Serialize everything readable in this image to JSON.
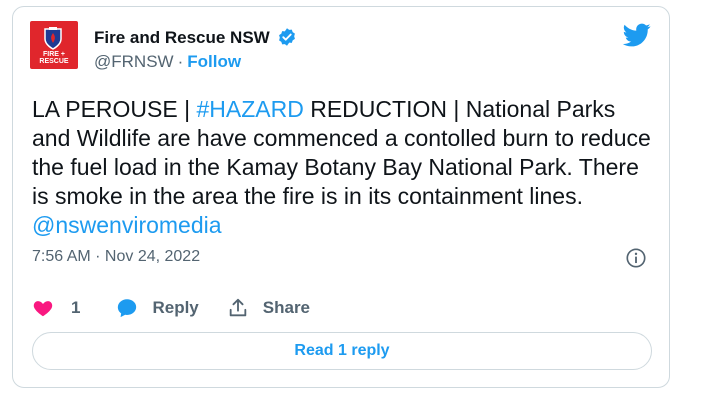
{
  "author": {
    "name": "Fire and Rescue NSW",
    "handle": "@FRNSW",
    "separator": "·",
    "follow_label": "Follow",
    "avatar_text": "FIRE + RESCUE",
    "verified_icon": "verified-badge-icon"
  },
  "tweet": {
    "part1": "LA PEROUSE | ",
    "hashtag": "#HAZARD",
    "part2": " REDUCTION | National Parks and Wildlife are have commenced a contolled burn to reduce the fuel load in the Kamay Botany Bay National Park. There is smoke in the area the fire is in its containment lines. ",
    "mention": "@nswenviromedia"
  },
  "timestamp": "7:56 AM · Nov 24, 2022",
  "actions": {
    "like_count": "1",
    "reply_label": "Reply",
    "share_label": "Share"
  },
  "read_replies_label": "Read 1 reply",
  "colors": {
    "accent": "#1d9bf0",
    "like": "#f91880",
    "text": "#0f1419",
    "secondary": "#536471",
    "brand_red": "#e0262c"
  }
}
